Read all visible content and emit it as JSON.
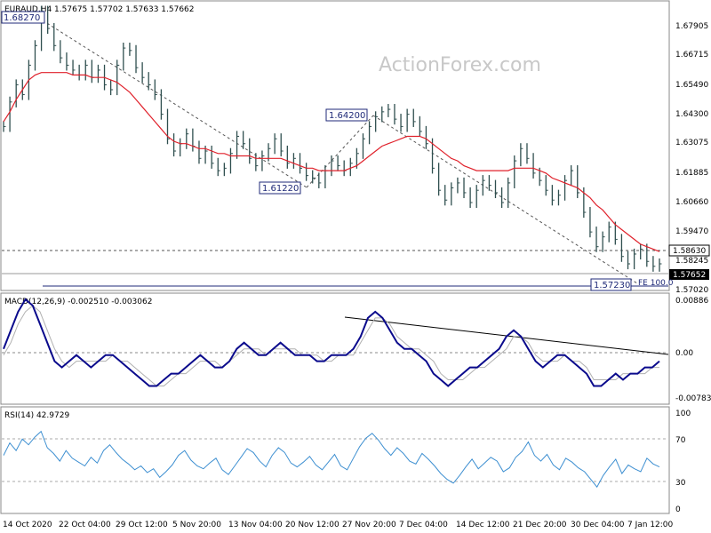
{
  "header": {
    "main": "EURAUD,H4  1.57675 1.57702 1.57633 1.57662",
    "macd": "MACD(12,26,9) -0.002510 -0.003062",
    "rsi": "RSI(14) 42.9729"
  },
  "watermark": "ActionForex.com",
  "price_axis": [
    "1.67905",
    "1.66715",
    "1.65490",
    "1.64300",
    "1.63075",
    "1.61885",
    "1.60660",
    "1.59470",
    "1.58245",
    "1.57020"
  ],
  "price_markers": {
    "level_box": "1.58630",
    "current_box": "1.57652"
  },
  "macd_axis": [
    "0.00886",
    "0.00",
    "-0.007834"
  ],
  "rsi_axis": [
    "100",
    "70",
    "30",
    "0"
  ],
  "time_axis": [
    "14 Oct 2020",
    "22 Oct 04:00",
    "29 Oct 12:00",
    "5 Nov 20:00",
    "13 Nov 04:00",
    "20 Nov 12:00",
    "27 Nov 20:00",
    "7 Dec 04:00",
    "14 Dec 12:00",
    "21 Dec 20:00",
    "30 Dec 04:00",
    "7 Jan 12:00"
  ],
  "annotations": {
    "a1": "1.68270",
    "a2": "1.64200",
    "a3": "1.61220",
    "a4": "1.57230",
    "fib": "FE 100.0"
  },
  "chart_data": [
    {
      "type": "line",
      "title": "EURAUD,H4",
      "subtitle": "1.57675 1.57702 1.57633 1.57662",
      "series": [
        {
          "values": [
            1.635,
            1.645,
            1.652,
            1.648,
            1.66,
            1.668,
            1.682,
            1.675,
            1.668,
            1.663,
            1.66,
            1.658,
            1.656,
            1.66,
            1.655,
            1.658,
            1.652,
            1.65,
            1.66,
            1.667,
            1.666,
            1.659,
            1.655,
            1.652,
            1.648,
            1.64,
            1.63,
            1.625,
            1.628,
            1.632,
            1.627,
            1.622,
            1.625,
            1.62,
            1.617,
            1.618,
            1.624,
            1.631,
            1.628,
            1.622,
            1.619,
            1.623,
            1.626,
            1.63,
            1.625,
            1.62,
            1.622,
            1.618,
            1.615,
            1.614,
            1.612,
            1.617,
            1.621,
            1.619,
            1.617,
            1.62,
            1.624,
            1.63,
            1.635,
            1.639,
            1.641,
            1.642,
            1.638,
            1.635,
            1.64,
            1.637,
            1.633,
            1.628,
            1.618,
            1.609,
            1.605,
            1.61,
            1.612,
            1.608,
            1.604,
            1.609,
            1.613,
            1.611,
            1.608,
            1.604,
            1.612,
            1.621,
            1.626,
            1.622,
            1.616,
            1.613,
            1.609,
            1.605,
            1.607,
            1.613,
            1.617,
            1.608,
            1.6,
            1.592,
            1.586,
            1.59,
            1.594,
            1.589,
            1.582,
            1.579,
            1.583,
            1.585,
            1.58,
            1.578,
            1.579
          ],
          "color": "#2f4f4f"
        },
        {
          "values": [
            1.637,
            1.641,
            1.646,
            1.65,
            1.654,
            1.656,
            1.657,
            1.657,
            1.657,
            1.657,
            1.657,
            1.656,
            1.656,
            1.656,
            1.655,
            1.655,
            1.655,
            1.654,
            1.653,
            1.651,
            1.649,
            1.646,
            1.643,
            1.64,
            1.637,
            1.634,
            1.631,
            1.629,
            1.628,
            1.628,
            1.627,
            1.626,
            1.626,
            1.625,
            1.624,
            1.624,
            1.623,
            1.623,
            1.623,
            1.623,
            1.622,
            1.622,
            1.622,
            1.622,
            1.622,
            1.621,
            1.62,
            1.619,
            1.618,
            1.618,
            1.617,
            1.617,
            1.617,
            1.617,
            1.617,
            1.618,
            1.619,
            1.621,
            1.623,
            1.625,
            1.627,
            1.628,
            1.629,
            1.63,
            1.631,
            1.631,
            1.631,
            1.63,
            1.628,
            1.626,
            1.624,
            1.622,
            1.621,
            1.619,
            1.618,
            1.617,
            1.617,
            1.617,
            1.617,
            1.617,
            1.617,
            1.618,
            1.618,
            1.618,
            1.618,
            1.617,
            1.616,
            1.614,
            1.613,
            1.612,
            1.611,
            1.61,
            1.608,
            1.606,
            1.603,
            1.601,
            1.598,
            1.595,
            1.593,
            1.591,
            1.589,
            1.587,
            1.586,
            1.585,
            1.584
          ],
          "color": "#e0212b"
        }
      ],
      "ylim": [
        1.5685,
        1.6855
      ]
    },
    {
      "type": "line",
      "title": "MACD(12,26,9)",
      "subtitle": "-0.002510 -0.003062",
      "series": [
        {
          "values": [
            0.0,
            0.003,
            0.006,
            0.008,
            0.007,
            0.004,
            0.001,
            -0.002,
            -0.003,
            -0.002,
            -0.001,
            -0.002,
            -0.003,
            -0.002,
            -0.001,
            -0.001,
            -0.002,
            -0.003,
            -0.004,
            -0.005,
            -0.006,
            -0.006,
            -0.005,
            -0.004,
            -0.004,
            -0.003,
            -0.002,
            -0.001,
            -0.002,
            -0.003,
            -0.003,
            -0.002,
            0.0,
            0.001,
            0.0,
            -0.001,
            -0.001,
            0.0,
            0.001,
            0.0,
            -0.001,
            -0.001,
            -0.001,
            -0.002,
            -0.002,
            -0.001,
            -0.001,
            -0.001,
            0.0,
            0.002,
            0.005,
            0.006,
            0.005,
            0.003,
            0.001,
            0.0,
            0.0,
            -0.001,
            -0.002,
            -0.004,
            -0.005,
            -0.006,
            -0.005,
            -0.004,
            -0.003,
            -0.003,
            -0.002,
            -0.001,
            0.0,
            0.002,
            0.003,
            0.002,
            0.0,
            -0.002,
            -0.003,
            -0.002,
            -0.001,
            -0.001,
            -0.002,
            -0.003,
            -0.004,
            -0.006,
            -0.006,
            -0.005,
            -0.004,
            -0.005,
            -0.004,
            -0.004,
            -0.003,
            -0.003,
            -0.002
          ],
          "color": "#0a0a8c"
        },
        {
          "values": [
            -0.001,
            0.001,
            0.004,
            0.006,
            0.007,
            0.006,
            0.003,
            0.0,
            -0.002,
            -0.003,
            -0.002,
            -0.002,
            -0.002,
            -0.002,
            -0.002,
            -0.001,
            -0.002,
            -0.002,
            -0.003,
            -0.004,
            -0.005,
            -0.006,
            -0.006,
            -0.005,
            -0.004,
            -0.004,
            -0.003,
            -0.002,
            -0.002,
            -0.002,
            -0.003,
            -0.002,
            -0.001,
            0.0,
            0.0,
            0.0,
            -0.001,
            0.0,
            0.0,
            0.0,
            0.0,
            -0.001,
            -0.001,
            -0.001,
            -0.002,
            -0.002,
            -0.001,
            -0.001,
            -0.001,
            0.001,
            0.003,
            0.005,
            0.005,
            0.004,
            0.002,
            0.001,
            0.0,
            0.0,
            -0.001,
            -0.002,
            -0.004,
            -0.005,
            -0.005,
            -0.005,
            -0.004,
            -0.003,
            -0.003,
            -0.002,
            -0.001,
            0.0,
            0.002,
            0.002,
            0.001,
            -0.001,
            -0.002,
            -0.002,
            -0.002,
            -0.001,
            -0.002,
            -0.002,
            -0.003,
            -0.005,
            -0.005,
            -0.005,
            -0.005,
            -0.004,
            -0.004,
            -0.004,
            -0.004,
            -0.003,
            -0.003
          ],
          "color": "#b0b0b0"
        }
      ],
      "ylim": [
        -0.0088,
        0.00886
      ]
    },
    {
      "type": "line",
      "title": "RSI(14)",
      "subtitle": "42.9729",
      "series": [
        {
          "values": [
            55,
            68,
            60,
            72,
            66,
            74,
            80,
            63,
            57,
            49,
            60,
            52,
            48,
            44,
            53,
            47,
            60,
            66,
            58,
            51,
            46,
            40,
            44,
            37,
            41,
            32,
            38,
            45,
            55,
            60,
            50,
            44,
            41,
            47,
            52,
            40,
            35,
            44,
            53,
            62,
            58,
            49,
            43,
            55,
            63,
            58,
            47,
            43,
            48,
            54,
            45,
            40,
            48,
            56,
            44,
            40,
            52,
            64,
            73,
            78,
            71,
            62,
            55,
            63,
            57,
            49,
            46,
            57,
            51,
            44,
            36,
            30,
            26,
            34,
            43,
            51,
            41,
            47,
            53,
            49,
            38,
            42,
            53,
            59,
            69,
            55,
            49,
            56,
            45,
            40,
            52,
            48,
            42,
            38,
            30,
            22,
            34,
            43,
            51,
            36,
            45,
            41,
            38,
            52,
            46,
            43
          ],
          "color": "#3d8fd1"
        }
      ],
      "ylim": [
        0,
        100
      ]
    }
  ]
}
